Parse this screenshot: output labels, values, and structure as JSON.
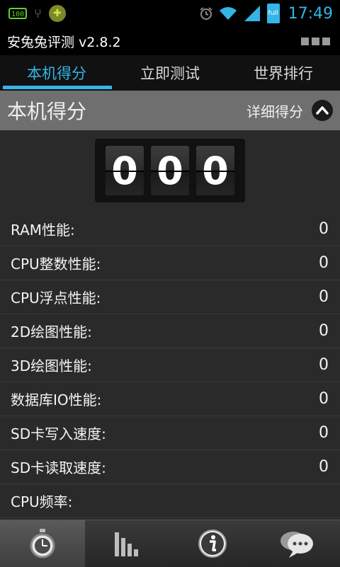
{
  "status_bar": {
    "notif_battery_text": "100",
    "time": "17:49",
    "battery_label": "full"
  },
  "app": {
    "title": "安兔兔评测 v2.8.2"
  },
  "tabs": [
    {
      "label": "本机得分",
      "active": true
    },
    {
      "label": "立即测试",
      "active": false
    },
    {
      "label": "世界排行",
      "active": false
    }
  ],
  "section": {
    "title": "本机得分",
    "detail_label": "详细得分"
  },
  "score_digits": [
    "0",
    "0",
    "0"
  ],
  "scores": [
    {
      "label": "RAM性能:",
      "value": "0"
    },
    {
      "label": "CPU整数性能:",
      "value": "0"
    },
    {
      "label": "CPU浮点性能:",
      "value": "0"
    },
    {
      "label": "2D绘图性能:",
      "value": "0"
    },
    {
      "label": "3D绘图性能:",
      "value": "0"
    },
    {
      "label": "数据库IO性能:",
      "value": "0"
    },
    {
      "label": "SD卡写入速度:",
      "value": "0"
    },
    {
      "label": "SD卡读取速度:",
      "value": "0"
    },
    {
      "label": "CPU频率:",
      "value": ""
    }
  ],
  "bottom_nav": [
    {
      "icon": "stopwatch-icon",
      "active": true
    },
    {
      "icon": "bar-chart-icon",
      "active": false
    },
    {
      "icon": "info-icon",
      "active": false
    },
    {
      "icon": "chat-bubble-icon",
      "active": false
    }
  ],
  "colors": {
    "accent": "#33b5e5",
    "background": "#2a2a2a",
    "section_header": "#6f6f6f"
  }
}
